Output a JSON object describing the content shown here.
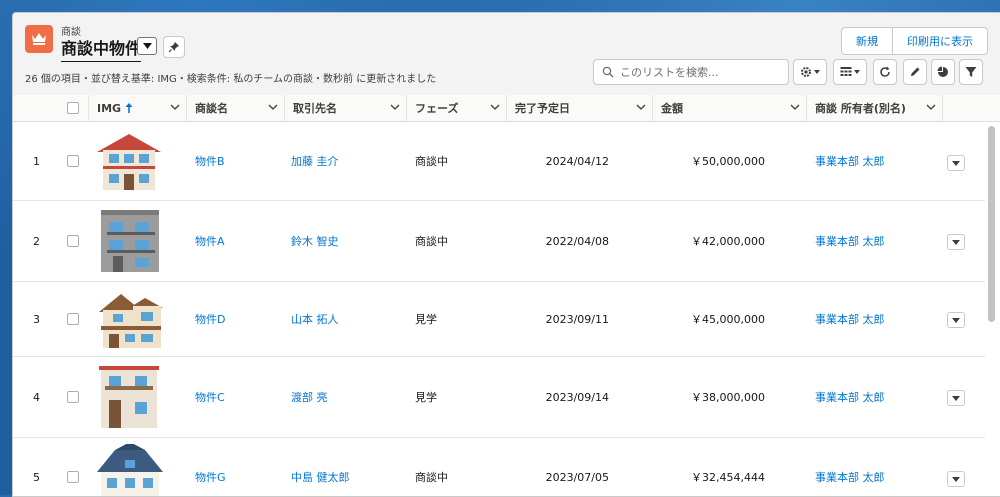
{
  "header": {
    "object_label": "商談",
    "list_title": "商談中物件",
    "subtitle": "26 個の項目・並び替え基準: IMG・検索条件: 私のチームの商談・数秒前 に更新されました",
    "buttons": {
      "new": "新規",
      "print": "印刷用に表示"
    },
    "search_placeholder": "このリストを検索..."
  },
  "columns": {
    "img": "IMG",
    "name": "商談名",
    "account": "取引先名",
    "stage": "フェーズ",
    "close_date": "完了予定日",
    "amount": "金額",
    "owner": "商談 所有者(別名)"
  },
  "rows": [
    {
      "num": "1",
      "name": "物件B",
      "account": "加藤 圭介",
      "stage": "商談中",
      "close_date": "2024/04/12",
      "amount": "￥50,000,000",
      "owner": "事業本部 太郎",
      "house_style": "two-story-red-roof"
    },
    {
      "num": "2",
      "name": "物件A",
      "account": "鈴木 智史",
      "stage": "商談中",
      "close_date": "2022/04/08",
      "amount": "￥42,000,000",
      "owner": "事業本部 太郎",
      "house_style": "gray-apartment"
    },
    {
      "num": "3",
      "name": "物件D",
      "account": "山本 拓人",
      "stage": "見学",
      "close_date": "2023/09/11",
      "amount": "￥45,000,000",
      "owner": "事業本部 太郎",
      "house_style": "brown-roof-house"
    },
    {
      "num": "4",
      "name": "物件C",
      "account": "渡部 亮",
      "stage": "見学",
      "close_date": "2023/09/14",
      "amount": "￥38,000,000",
      "owner": "事業本部 太郎",
      "house_style": "beige-flat-house"
    },
    {
      "num": "5",
      "name": "物件G",
      "account": "中島 健太郎",
      "stage": "商談中",
      "close_date": "2023/07/05",
      "amount": "￥32,454,444",
      "owner": "事業本部 太郎",
      "house_style": "blue-roof-house"
    }
  ],
  "colors": {
    "brand_icon": "#ef6e48",
    "link": "#0176d3",
    "background": "#1f5fa0"
  }
}
